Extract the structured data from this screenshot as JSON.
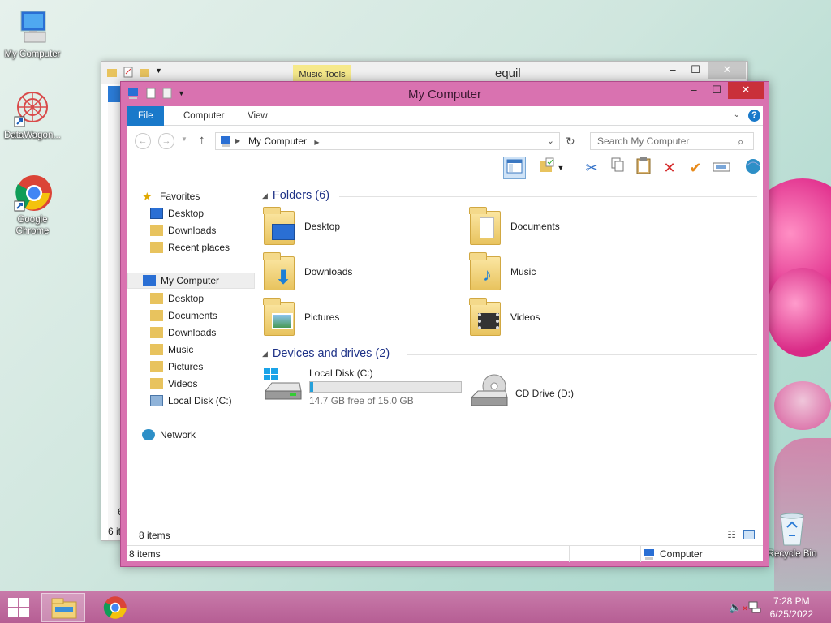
{
  "desktop": {
    "icons": [
      {
        "label": "My Computer"
      },
      {
        "label": "DataWagon..."
      },
      {
        "label": "Google Chrome"
      },
      {
        "label": "Recycle Bin"
      }
    ]
  },
  "back_window": {
    "title": "equil",
    "contextual_tab": "Music Tools",
    "status_count": "6 it",
    "partial_label": "6"
  },
  "window": {
    "title": "My Computer",
    "ribbon_tabs": [
      "File",
      "Computer",
      "View"
    ],
    "address": {
      "root": "My Computer"
    },
    "search_placeholder": "Search My Computer",
    "nav": {
      "favorites": "Favorites",
      "favorites_items": [
        "Desktop",
        "Downloads",
        "Recent places"
      ],
      "computer": "My Computer",
      "computer_items": [
        "Desktop",
        "Documents",
        "Downloads",
        "Music",
        "Pictures",
        "Videos",
        "Local Disk (C:)"
      ],
      "network": "Network"
    },
    "folders_header": "Folders (6)",
    "folders": [
      "Desktop",
      "Documents",
      "Downloads",
      "Music",
      "Pictures",
      "Videos"
    ],
    "drives_header": "Devices and drives (2)",
    "drives": [
      {
        "name": "Local Disk (C:)",
        "free": "14.7 GB free of 15.0 GB",
        "used_fraction": 0.02
      },
      {
        "name": "CD Drive (D:)"
      }
    ],
    "inner_status": "8 items",
    "status_items": "8 items",
    "status_location": "Computer"
  },
  "taskbar": {
    "time": "7:28 PM",
    "date": "6/25/2022"
  },
  "colors": {
    "accent": "#1979ca",
    "window_frame": "#d972b0",
    "close": "#c9303a",
    "taskbar": "#b65e94",
    "drive_bar": "#26a0da"
  }
}
